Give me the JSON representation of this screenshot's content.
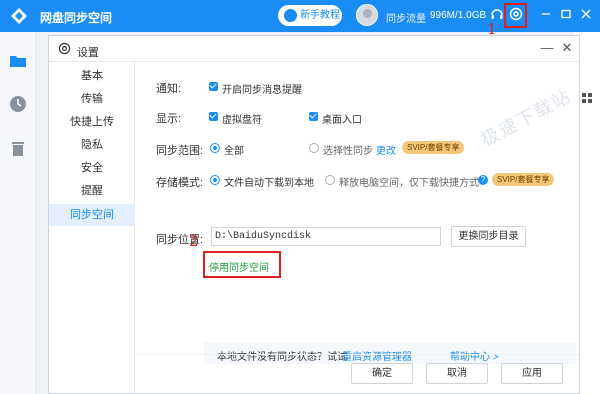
{
  "app": {
    "title": "网盘同步空间",
    "tutorial_label": "新手教程",
    "flow_label": "同步流量",
    "flow_value": "996M/1.0GB"
  },
  "dialog": {
    "title": "设置"
  },
  "nav": [
    "基本",
    "传输",
    "快捷上传",
    "隐私",
    "安全",
    "提醒",
    "同步空间"
  ],
  "notify": {
    "label": "通知:",
    "option": "开启同步消息提醒"
  },
  "display": {
    "label": "显示:",
    "option1": "虚拟盘符",
    "option2": "桌面入口"
  },
  "scope": {
    "label": "同步范围:",
    "all": "全部",
    "selective": "选择性同步",
    "change": "更改",
    "badge": "SVIP/套餐专享"
  },
  "storage": {
    "label": "存储模式:",
    "auto": "文件自动下载到本地",
    "free": "释放电脑空间，仅下载快捷方式",
    "badge": "SVIP/套餐专享",
    "help": "?"
  },
  "location": {
    "label": "同步位置:",
    "path": "D:\\BaiduSyncdisk",
    "change_button": "更换同步目录"
  },
  "stop_link": "停用同步空间",
  "tip": {
    "text": "本地文件没有同步状态？试试",
    "link": "重启资源管理器",
    "help": "帮助中心 >"
  },
  "buttons": {
    "ok": "确定",
    "cancel": "取消",
    "apply": "应用"
  },
  "annotations": {
    "one": "1",
    "two": "2"
  },
  "watermark": "极速下载站",
  "colors": {
    "accent": "#1a8cf5",
    "annotation": "#e02020",
    "stop_link": "#1f9d3a",
    "badge": "#f3c77a"
  }
}
